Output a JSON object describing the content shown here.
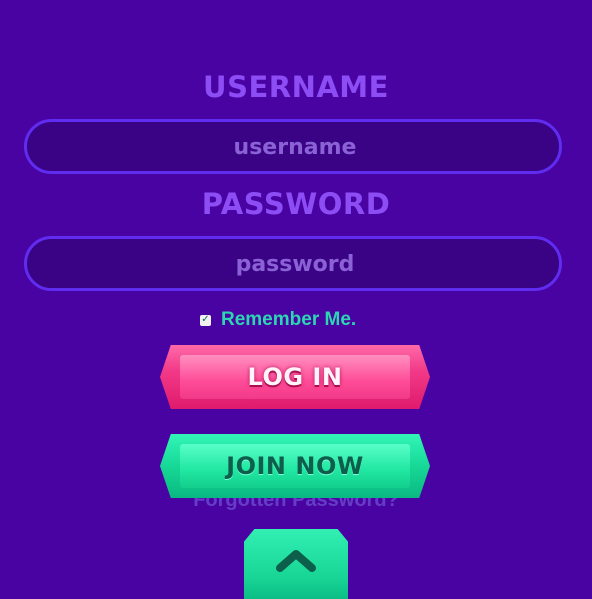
{
  "form": {
    "username_label": "USERNAME",
    "username_placeholder": "username",
    "password_label": "PASSWORD",
    "password_placeholder": "password",
    "remember_label": "Remember Me.",
    "remember_checked": true
  },
  "buttons": {
    "login_label": "LOG IN",
    "join_label": "JOIN NOW",
    "forgot_label": "Forgotten Password?"
  },
  "icons": {
    "checkbox": "check-icon",
    "scroll_up": "chevron-up-icon"
  },
  "colors": {
    "background": "#4a03a3",
    "label": "#8d4df4",
    "field_border": "#5f2cf0",
    "remember_text": "#2cd6b2",
    "login_button": "#f23a88",
    "join_button": "#17d896"
  }
}
